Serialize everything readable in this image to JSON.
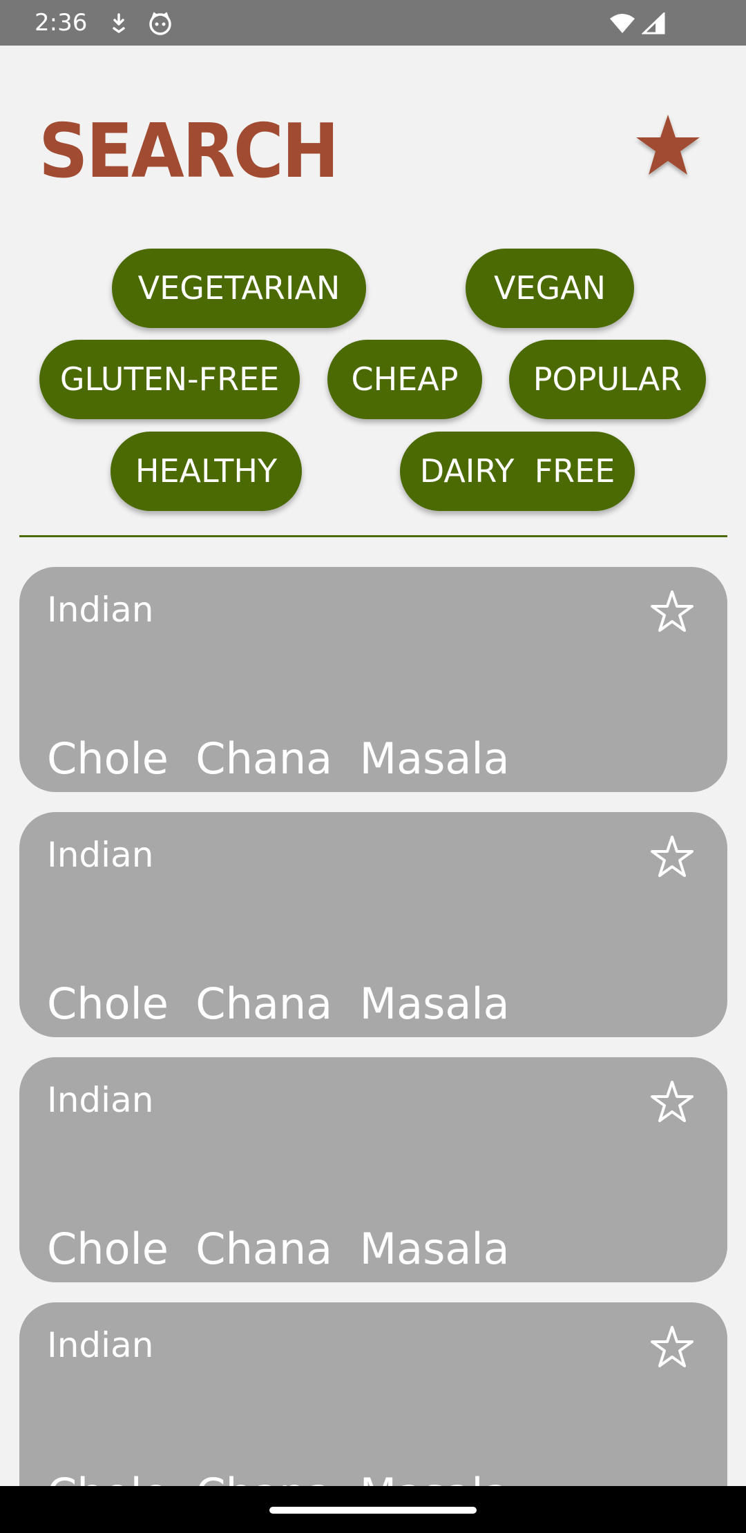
{
  "status_bar": {
    "time": "2:36",
    "icons": [
      "download-icon",
      "cat-face-icon",
      "wifi-icon",
      "signal-icon"
    ]
  },
  "header": {
    "title": "SEARCH",
    "favorites_icon": "star-filled-icon"
  },
  "filters": [
    {
      "label": "VEGETARIAN"
    },
    {
      "label": "VEGAN"
    },
    {
      "label": "GLUTEN-FREE"
    },
    {
      "label": "CHEAP"
    },
    {
      "label": "POPULAR"
    },
    {
      "label": "HEALTHY"
    },
    {
      "label": "DAIRY  FREE"
    }
  ],
  "recipes": [
    {
      "cuisine": "Indian",
      "name": "Chole  Chana  Masala",
      "favorite_icon": "star-outline-icon"
    },
    {
      "cuisine": "Indian",
      "name": "Chole  Chana  Masala",
      "favorite_icon": "star-outline-icon"
    },
    {
      "cuisine": "Indian",
      "name": "Chole  Chana  Masala",
      "favorite_icon": "star-outline-icon"
    },
    {
      "cuisine": "Indian",
      "name": "Chole  Chana  Masala",
      "favorite_icon": "star-outline-icon"
    }
  ],
  "colors": {
    "title": "#a14c32",
    "chip": "#4c6a04",
    "card": "#a8a8a8",
    "background": "#f2f2f2"
  }
}
